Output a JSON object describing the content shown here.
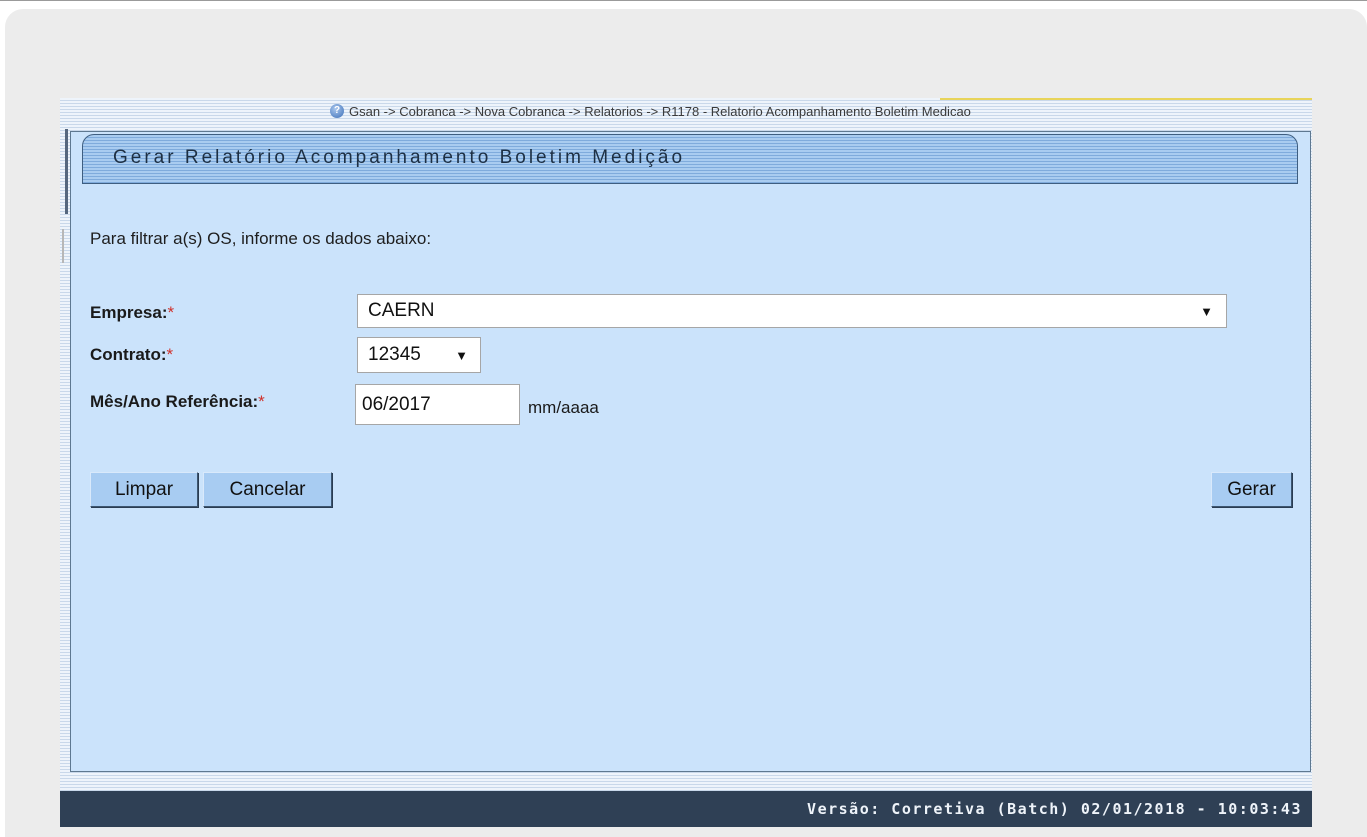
{
  "breadcrumb": {
    "text": "Gsan -> Cobranca -> Nova Cobranca -> Relatorios -> R1178 - Relatorio Acompanhamento Boletim Medicao"
  },
  "page": {
    "title": "Gerar Relatório Acompanhamento Boletim Medição",
    "instructions": "Para filtrar a(s) OS, informe os dados abaixo:"
  },
  "form": {
    "empresa_label": "Empresa:",
    "empresa_value": "CAERN",
    "contrato_label": "Contrato:",
    "contrato_value": "12345",
    "mes_ano_label": "Mês/Ano Referência:",
    "mes_ano_value": "06/2017",
    "mes_ano_hint": "mm/aaaa",
    "required_marker": "*"
  },
  "buttons": {
    "limpar": "Limpar",
    "cancelar": "Cancelar",
    "gerar": "Gerar"
  },
  "footer": {
    "version": "Versão: Corretiva (Batch) 02/01/2018 - 10:03:43"
  },
  "icons": {
    "help": "help-icon",
    "dropdown": "chevron-down-icon"
  },
  "colors": {
    "content_bg": "#cbe3fb",
    "footer_bg": "#2f4055",
    "button_bg": "#a8ccf2",
    "required": "#d0302a"
  }
}
